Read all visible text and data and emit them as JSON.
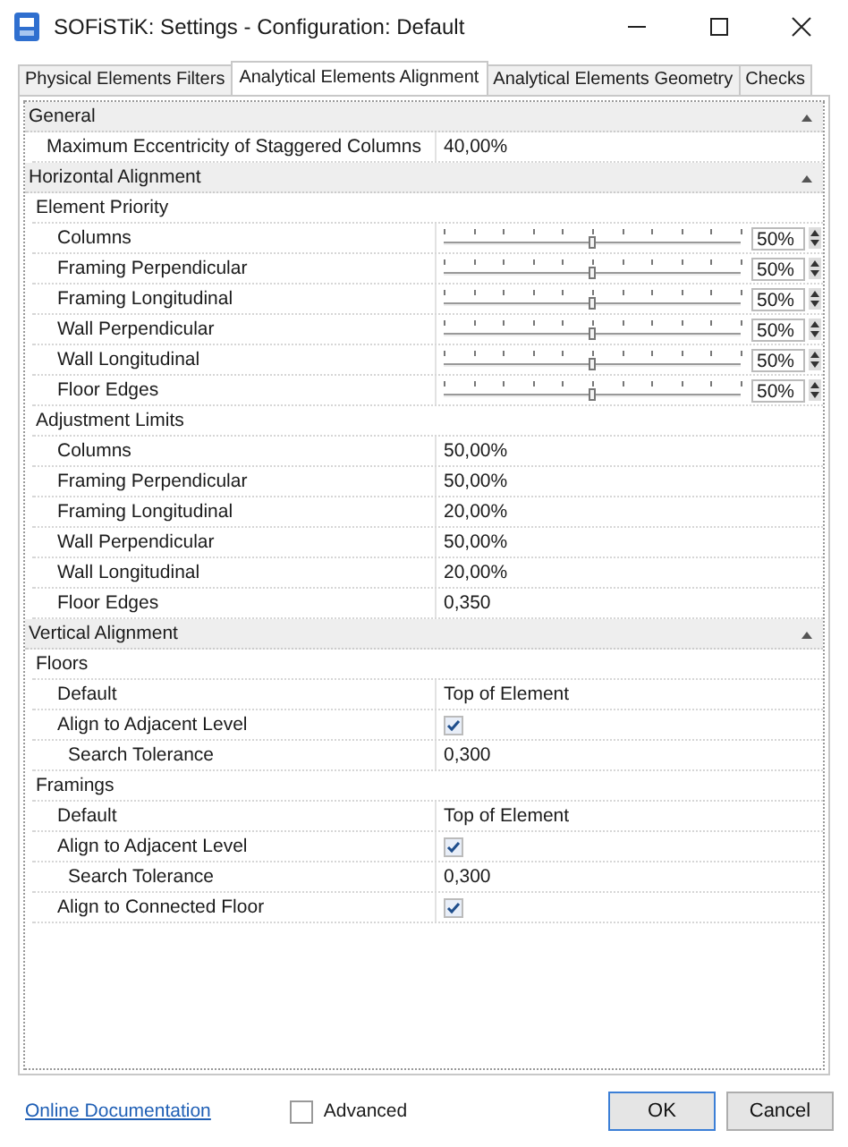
{
  "window": {
    "title": "SOFiSTiK: Settings - Configuration: Default"
  },
  "tabs": [
    {
      "label": "Physical Elements Filters",
      "selected": false
    },
    {
      "label": "Analytical Elements Alignment",
      "selected": true
    },
    {
      "label": "Analytical Elements Geometry",
      "selected": false
    },
    {
      "label": "Checks",
      "selected": false
    }
  ],
  "sections": [
    {
      "title": "General",
      "expanded": true,
      "items": [
        {
          "kind": "text",
          "label": "Maximum Eccentricity of Staggered Columns",
          "value": "40,00%"
        }
      ]
    },
    {
      "title": "Horizontal Alignment",
      "expanded": true,
      "items": [
        {
          "kind": "group",
          "label": "Element Priority",
          "children": [
            {
              "kind": "slider",
              "label": "Columns",
              "level": 0.5,
              "value": "50%"
            },
            {
              "kind": "slider",
              "label": "Framing Perpendicular",
              "level": 0.5,
              "value": "50%"
            },
            {
              "kind": "slider",
              "label": "Framing Longitudinal",
              "level": 0.5,
              "value": "50%"
            },
            {
              "kind": "slider",
              "label": "Wall Perpendicular",
              "level": 0.5,
              "value": "50%"
            },
            {
              "kind": "slider",
              "label": "Wall Longitudinal",
              "level": 0.5,
              "value": "50%"
            },
            {
              "kind": "slider",
              "label": "Floor Edges",
              "level": 0.5,
              "value": "50%"
            }
          ]
        },
        {
          "kind": "group",
          "label": "Adjustment Limits",
          "children": [
            {
              "kind": "text",
              "label": "Columns",
              "value": "50,00%"
            },
            {
              "kind": "text",
              "label": "Framing Perpendicular",
              "value": "50,00%"
            },
            {
              "kind": "text",
              "label": "Framing Longitudinal",
              "value": "20,00%"
            },
            {
              "kind": "text",
              "label": "Wall Perpendicular",
              "value": "50,00%"
            },
            {
              "kind": "text",
              "label": "Wall Longitudinal",
              "value": "20,00%"
            },
            {
              "kind": "text",
              "label": "Floor Edges",
              "value": "0,350"
            }
          ]
        }
      ]
    },
    {
      "title": "Vertical Alignment",
      "expanded": true,
      "items": [
        {
          "kind": "group",
          "label": "Floors",
          "children": [
            {
              "kind": "text",
              "label": "Default",
              "value": "Top of Element"
            },
            {
              "kind": "check",
              "label": "Align to Adjacent Level",
              "checked": true,
              "children": [
                {
                  "kind": "text",
                  "label": "Search Tolerance",
                  "value": "0,300"
                }
              ]
            }
          ]
        },
        {
          "kind": "group",
          "label": "Framings",
          "children": [
            {
              "kind": "text",
              "label": "Default",
              "value": "Top of Element"
            },
            {
              "kind": "check",
              "label": "Align to Adjacent Level",
              "checked": true,
              "children": [
                {
                  "kind": "text",
                  "label": "Search Tolerance",
                  "value": "0,300"
                }
              ]
            },
            {
              "kind": "check",
              "label": "Align to Connected Floor",
              "checked": true
            }
          ]
        }
      ]
    }
  ],
  "footer": {
    "link": "Online Documentation",
    "advanced": {
      "label": "Advanced",
      "checked": false
    },
    "buttons": [
      "OK",
      "Cancel"
    ]
  }
}
